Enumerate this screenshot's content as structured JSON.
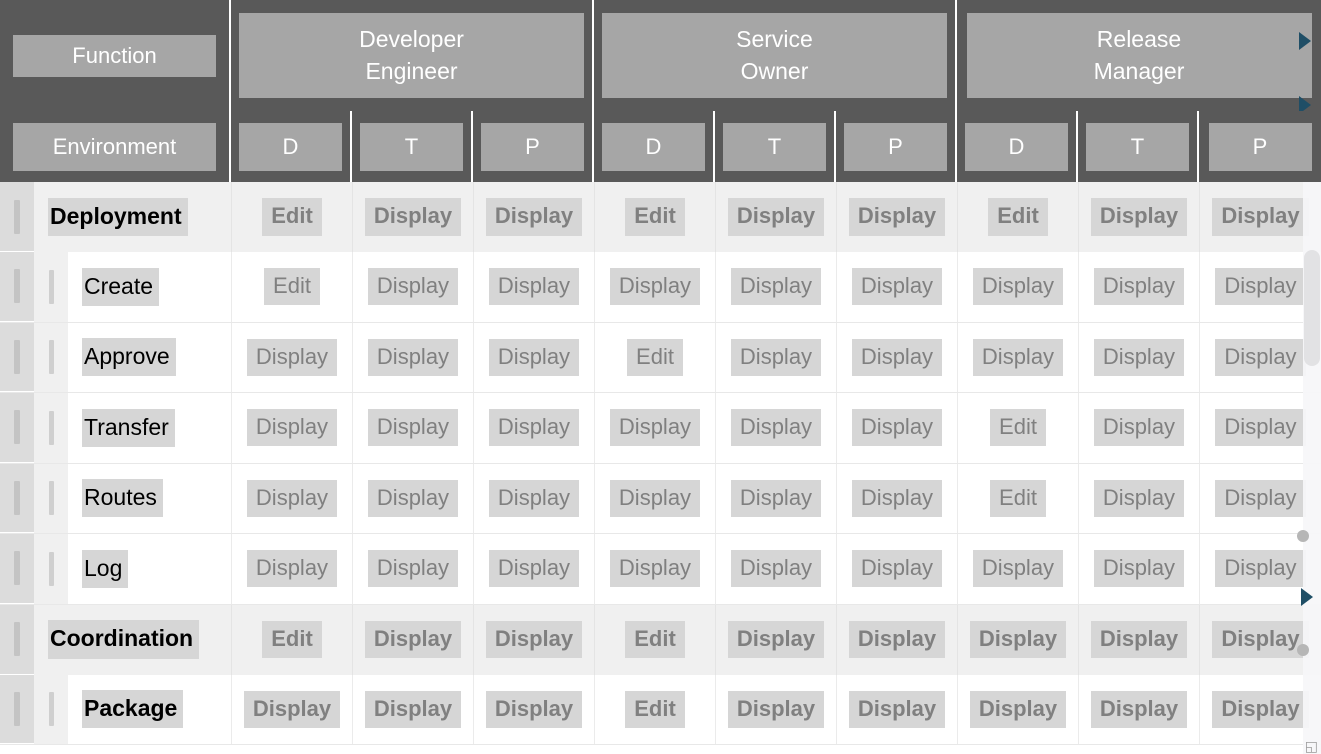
{
  "header": {
    "corner_function_label": "Function",
    "corner_environment_label": "Environment",
    "roles": [
      {
        "line1": "Developer",
        "line2": "Engineer"
      },
      {
        "line1": "Service",
        "line2": "Owner"
      },
      {
        "line1": "Release",
        "line2": "Manager"
      }
    ],
    "environments": [
      "D",
      "T",
      "P",
      "D",
      "T",
      "P",
      "D",
      "T",
      "P"
    ],
    "arrows": [
      {
        "name": "scroll-right-arrow-top",
        "glyph": "right"
      },
      {
        "name": "scroll-right-arrow-middle",
        "glyph": "right"
      },
      {
        "name": "scroll-down-arrow",
        "glyph": "down"
      }
    ]
  },
  "matrix": {
    "rows": [
      {
        "label": "Deployment",
        "type": "group",
        "bold": true,
        "values": [
          "Edit",
          "Display",
          "Display",
          "Edit",
          "Display",
          "Display",
          "Edit",
          "Display",
          "Display"
        ]
      },
      {
        "label": "Create",
        "type": "child",
        "bold": false,
        "values": [
          "Edit",
          "Display",
          "Display",
          "Display",
          "Display",
          "Display",
          "Display",
          "Display",
          "Display"
        ]
      },
      {
        "label": "Approve",
        "type": "child",
        "bold": false,
        "values": [
          "Display",
          "Display",
          "Display",
          "Edit",
          "Display",
          "Display",
          "Display",
          "Display",
          "Display"
        ]
      },
      {
        "label": "Transfer",
        "type": "child",
        "bold": false,
        "values": [
          "Display",
          "Display",
          "Display",
          "Display",
          "Display",
          "Display",
          "Edit",
          "Display",
          "Display"
        ]
      },
      {
        "label": "Routes",
        "type": "child",
        "bold": false,
        "values": [
          "Display",
          "Display",
          "Display",
          "Display",
          "Display",
          "Display",
          "Edit",
          "Display",
          "Display"
        ]
      },
      {
        "label": "Log",
        "type": "child",
        "bold": false,
        "values": [
          "Display",
          "Display",
          "Display",
          "Display",
          "Display",
          "Display",
          "Display",
          "Display",
          "Display"
        ]
      },
      {
        "label": "Coordination",
        "type": "group",
        "bold": true,
        "values": [
          "Edit",
          "Display",
          "Display",
          "Edit",
          "Display",
          "Display",
          "Display",
          "Display",
          "Display"
        ]
      },
      {
        "label": "Package",
        "type": "child",
        "bold": true,
        "values": [
          "Display",
          "Display",
          "Display",
          "Edit",
          "Display",
          "Display",
          "Display",
          "Display",
          "Display"
        ]
      }
    ]
  },
  "scrollbar": {
    "orientation": "vertical",
    "thumb_label": "vertical-scroll-thumb",
    "dots": 2,
    "marker_glyph": "right"
  },
  "corner": {
    "glyph": "◱"
  },
  "colors": {
    "header_background": "#595959",
    "header_chip": "#a6a6a6",
    "header_chip_text": "#ffffff",
    "group_row_background": "#f0f0f0",
    "child_row_background": "#ffffff",
    "cell_chip": "#d6d6d6",
    "cell_chip_text": "#808080",
    "label_text": "#000000",
    "gutter": "#dcdcdc",
    "arrow": "#1f4e66"
  }
}
